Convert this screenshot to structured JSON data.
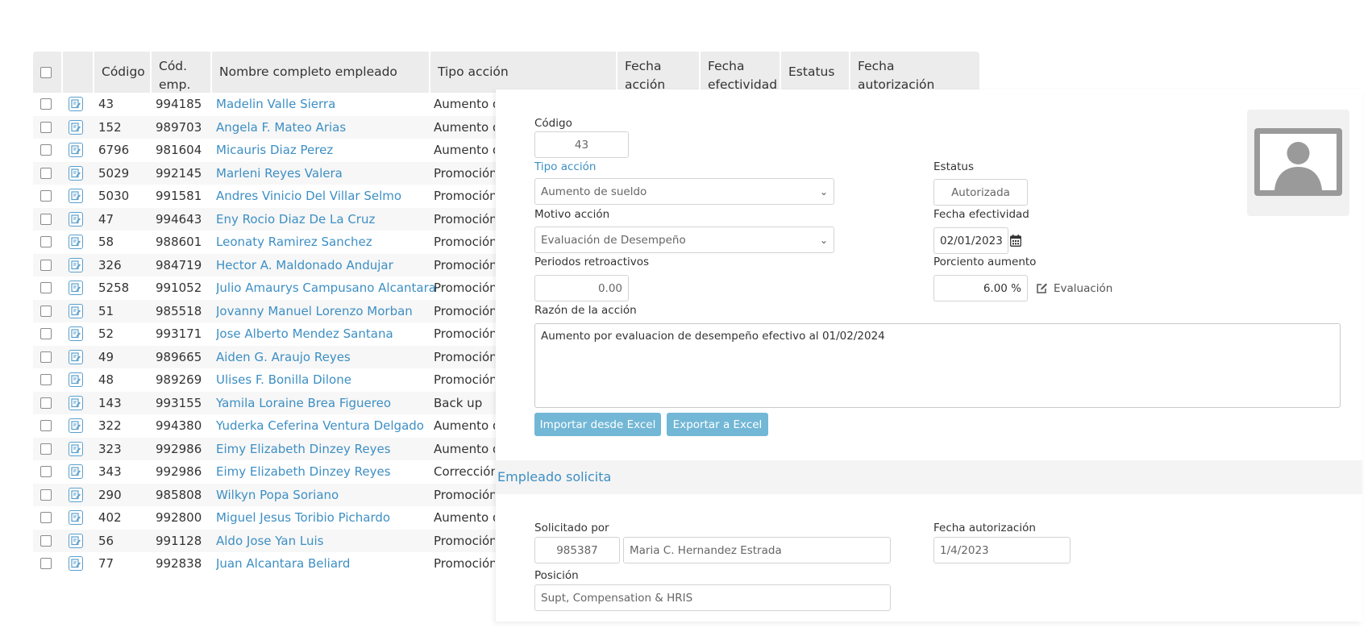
{
  "table": {
    "headers": {
      "codigo": "Código",
      "cod_emp_1": "Cód.",
      "cod_emp_2": "emp.",
      "nombre": "Nombre completo empleado",
      "tipo": "Tipo acción",
      "fecha_accion_1": "Fecha",
      "fecha_accion_2": "acción",
      "fecha_efectividad_1": "Fecha",
      "fecha_efectividad_2": "efectividad",
      "estatus": "Estatus",
      "fecha_autorizacion_1": "Fecha",
      "fecha_autorizacion_2": "autorización"
    },
    "rows": [
      {
        "codigo": "43",
        "cod_emp": "994185",
        "nombre": "Madelin Valle Sierra",
        "tipo": "Aumento d"
      },
      {
        "codigo": "152",
        "cod_emp": "989703",
        "nombre": "Angela F. Mateo Arias",
        "tipo": "Aumento d"
      },
      {
        "codigo": "6796",
        "cod_emp": "981604",
        "nombre": "Micauris Diaz Perez",
        "tipo": "Aumento d"
      },
      {
        "codigo": "5029",
        "cod_emp": "992145",
        "nombre": "Marleni Reyes Valera",
        "tipo": "Promoción"
      },
      {
        "codigo": "5030",
        "cod_emp": "991581",
        "nombre": "Andres Vinicio Del Villar Selmo",
        "tipo": "Promoción"
      },
      {
        "codigo": "47",
        "cod_emp": "994643",
        "nombre": "Eny Rocio Diaz De La Cruz",
        "tipo": "Promoción"
      },
      {
        "codigo": "58",
        "cod_emp": "988601",
        "nombre": "Leonaty Ramirez Sanchez",
        "tipo": "Promoción"
      },
      {
        "codigo": "326",
        "cod_emp": "984719",
        "nombre": "Hector A. Maldonado Andujar",
        "tipo": "Promoción"
      },
      {
        "codigo": "5258",
        "cod_emp": "991052",
        "nombre": "Julio Amaurys Campusano Alcantara",
        "tipo": "Promoción"
      },
      {
        "codigo": "51",
        "cod_emp": "985518",
        "nombre": "Jovanny Manuel Lorenzo Morban",
        "tipo": "Promoción"
      },
      {
        "codigo": "52",
        "cod_emp": "993171",
        "nombre": "Jose Alberto Mendez Santana",
        "tipo": "Promoción"
      },
      {
        "codigo": "49",
        "cod_emp": "989665",
        "nombre": "Aiden G. Araujo Reyes",
        "tipo": "Promoción"
      },
      {
        "codigo": "48",
        "cod_emp": "989269",
        "nombre": "Ulises F. Bonilla Dilone",
        "tipo": "Promoción"
      },
      {
        "codigo": "143",
        "cod_emp": "993155",
        "nombre": "Yamila Loraine Brea Figuereo",
        "tipo": "Back up"
      },
      {
        "codigo": "322",
        "cod_emp": "994380",
        "nombre": "Yuderka Ceferina Ventura Delgado",
        "tipo": "Aumento d"
      },
      {
        "codigo": "323",
        "cod_emp": "992986",
        "nombre": "Eimy Elizabeth Dinzey Reyes",
        "tipo": "Aumento d"
      },
      {
        "codigo": "343",
        "cod_emp": "992986",
        "nombre": "Eimy Elizabeth Dinzey Reyes",
        "tipo": "Corrección"
      },
      {
        "codigo": "290",
        "cod_emp": "985808",
        "nombre": "Wilkyn Popa Soriano",
        "tipo": "Promoción"
      },
      {
        "codigo": "402",
        "cod_emp": "992800",
        "nombre": "Miguel Jesus Toribio Pichardo",
        "tipo": "Aumento d"
      },
      {
        "codigo": "56",
        "cod_emp": "991128",
        "nombre": "Aldo Jose Yan Luis",
        "tipo": "Promoción"
      },
      {
        "codigo": "77",
        "cod_emp": "992838",
        "nombre": "Juan Alcantara Beliard",
        "tipo": "Promoción"
      }
    ]
  },
  "form": {
    "codigo_label": "Código",
    "codigo_value": "43",
    "tipo_accion_label": "Tipo acción",
    "tipo_accion_value": "Aumento de sueldo",
    "estatus_label": "Estatus",
    "estatus_value": "Autorizada",
    "motivo_label": "Motivo acción",
    "motivo_value": "Evaluación de Desempeño",
    "fecha_efectividad_label": "Fecha efectividad",
    "fecha_efectividad_value": "02/01/2023",
    "periodos_label": "Periodos retroactivos",
    "periodos_value": "0.00",
    "porciento_label": "Porciento aumento",
    "porciento_value": "6.00 %",
    "evaluacion_label": "Evaluación",
    "razon_label": "Razón de la acción",
    "razon_value": "Aumento por evaluacion de desempeño efectivo al 01/02/2024",
    "import_button": "Importar desde Excel",
    "export_button": "Exportar a Excel",
    "section_title": "Empleado solicita",
    "solicitado_label": "Solicitado por",
    "solicitado_code": "985387",
    "solicitado_name": "Maria C. Hernandez Estrada",
    "fecha_autorizacion_label": "Fecha autorización",
    "fecha_autorizacion_value": "1/4/2023",
    "posicion_label": "Posición",
    "posicion_value": "Supt, Compensation & HRIS"
  },
  "icons": {
    "row_edit": "edit-document-icon",
    "calendar": "calendar-icon",
    "edit": "pencil-square-icon",
    "avatar": "user-avatar-placeholder-icon",
    "select": "chevron-down-icon"
  },
  "colors": {
    "link": "#3d8fc4",
    "button": "#72b7d6",
    "header_bg": "#ececec"
  }
}
